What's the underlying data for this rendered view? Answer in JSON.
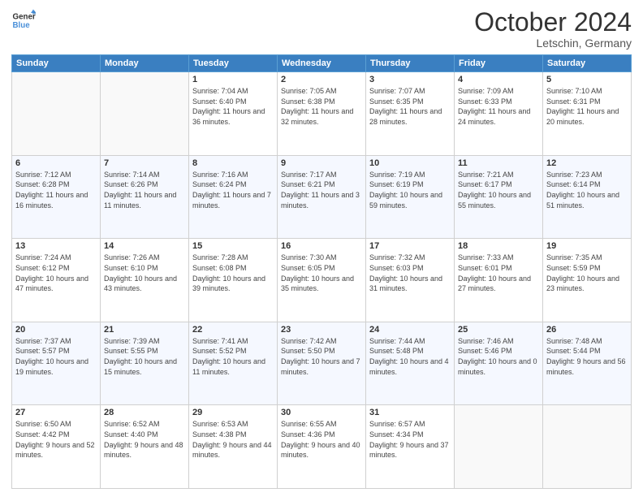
{
  "header": {
    "logo_line1": "General",
    "logo_line2": "Blue",
    "month": "October 2024",
    "location": "Letschin, Germany"
  },
  "days_of_week": [
    "Sunday",
    "Monday",
    "Tuesday",
    "Wednesday",
    "Thursday",
    "Friday",
    "Saturday"
  ],
  "weeks": [
    [
      {
        "day": "",
        "info": ""
      },
      {
        "day": "",
        "info": ""
      },
      {
        "day": "1",
        "info": "Sunrise: 7:04 AM\nSunset: 6:40 PM\nDaylight: 11 hours and 36 minutes."
      },
      {
        "day": "2",
        "info": "Sunrise: 7:05 AM\nSunset: 6:38 PM\nDaylight: 11 hours and 32 minutes."
      },
      {
        "day": "3",
        "info": "Sunrise: 7:07 AM\nSunset: 6:35 PM\nDaylight: 11 hours and 28 minutes."
      },
      {
        "day": "4",
        "info": "Sunrise: 7:09 AM\nSunset: 6:33 PM\nDaylight: 11 hours and 24 minutes."
      },
      {
        "day": "5",
        "info": "Sunrise: 7:10 AM\nSunset: 6:31 PM\nDaylight: 11 hours and 20 minutes."
      }
    ],
    [
      {
        "day": "6",
        "info": "Sunrise: 7:12 AM\nSunset: 6:28 PM\nDaylight: 11 hours and 16 minutes."
      },
      {
        "day": "7",
        "info": "Sunrise: 7:14 AM\nSunset: 6:26 PM\nDaylight: 11 hours and 11 minutes."
      },
      {
        "day": "8",
        "info": "Sunrise: 7:16 AM\nSunset: 6:24 PM\nDaylight: 11 hours and 7 minutes."
      },
      {
        "day": "9",
        "info": "Sunrise: 7:17 AM\nSunset: 6:21 PM\nDaylight: 11 hours and 3 minutes."
      },
      {
        "day": "10",
        "info": "Sunrise: 7:19 AM\nSunset: 6:19 PM\nDaylight: 10 hours and 59 minutes."
      },
      {
        "day": "11",
        "info": "Sunrise: 7:21 AM\nSunset: 6:17 PM\nDaylight: 10 hours and 55 minutes."
      },
      {
        "day": "12",
        "info": "Sunrise: 7:23 AM\nSunset: 6:14 PM\nDaylight: 10 hours and 51 minutes."
      }
    ],
    [
      {
        "day": "13",
        "info": "Sunrise: 7:24 AM\nSunset: 6:12 PM\nDaylight: 10 hours and 47 minutes."
      },
      {
        "day": "14",
        "info": "Sunrise: 7:26 AM\nSunset: 6:10 PM\nDaylight: 10 hours and 43 minutes."
      },
      {
        "day": "15",
        "info": "Sunrise: 7:28 AM\nSunset: 6:08 PM\nDaylight: 10 hours and 39 minutes."
      },
      {
        "day": "16",
        "info": "Sunrise: 7:30 AM\nSunset: 6:05 PM\nDaylight: 10 hours and 35 minutes."
      },
      {
        "day": "17",
        "info": "Sunrise: 7:32 AM\nSunset: 6:03 PM\nDaylight: 10 hours and 31 minutes."
      },
      {
        "day": "18",
        "info": "Sunrise: 7:33 AM\nSunset: 6:01 PM\nDaylight: 10 hours and 27 minutes."
      },
      {
        "day": "19",
        "info": "Sunrise: 7:35 AM\nSunset: 5:59 PM\nDaylight: 10 hours and 23 minutes."
      }
    ],
    [
      {
        "day": "20",
        "info": "Sunrise: 7:37 AM\nSunset: 5:57 PM\nDaylight: 10 hours and 19 minutes."
      },
      {
        "day": "21",
        "info": "Sunrise: 7:39 AM\nSunset: 5:55 PM\nDaylight: 10 hours and 15 minutes."
      },
      {
        "day": "22",
        "info": "Sunrise: 7:41 AM\nSunset: 5:52 PM\nDaylight: 10 hours and 11 minutes."
      },
      {
        "day": "23",
        "info": "Sunrise: 7:42 AM\nSunset: 5:50 PM\nDaylight: 10 hours and 7 minutes."
      },
      {
        "day": "24",
        "info": "Sunrise: 7:44 AM\nSunset: 5:48 PM\nDaylight: 10 hours and 4 minutes."
      },
      {
        "day": "25",
        "info": "Sunrise: 7:46 AM\nSunset: 5:46 PM\nDaylight: 10 hours and 0 minutes."
      },
      {
        "day": "26",
        "info": "Sunrise: 7:48 AM\nSunset: 5:44 PM\nDaylight: 9 hours and 56 minutes."
      }
    ],
    [
      {
        "day": "27",
        "info": "Sunrise: 6:50 AM\nSunset: 4:42 PM\nDaylight: 9 hours and 52 minutes."
      },
      {
        "day": "28",
        "info": "Sunrise: 6:52 AM\nSunset: 4:40 PM\nDaylight: 9 hours and 48 minutes."
      },
      {
        "day": "29",
        "info": "Sunrise: 6:53 AM\nSunset: 4:38 PM\nDaylight: 9 hours and 44 minutes."
      },
      {
        "day": "30",
        "info": "Sunrise: 6:55 AM\nSunset: 4:36 PM\nDaylight: 9 hours and 40 minutes."
      },
      {
        "day": "31",
        "info": "Sunrise: 6:57 AM\nSunset: 4:34 PM\nDaylight: 9 hours and 37 minutes."
      },
      {
        "day": "",
        "info": ""
      },
      {
        "day": "",
        "info": ""
      }
    ]
  ]
}
